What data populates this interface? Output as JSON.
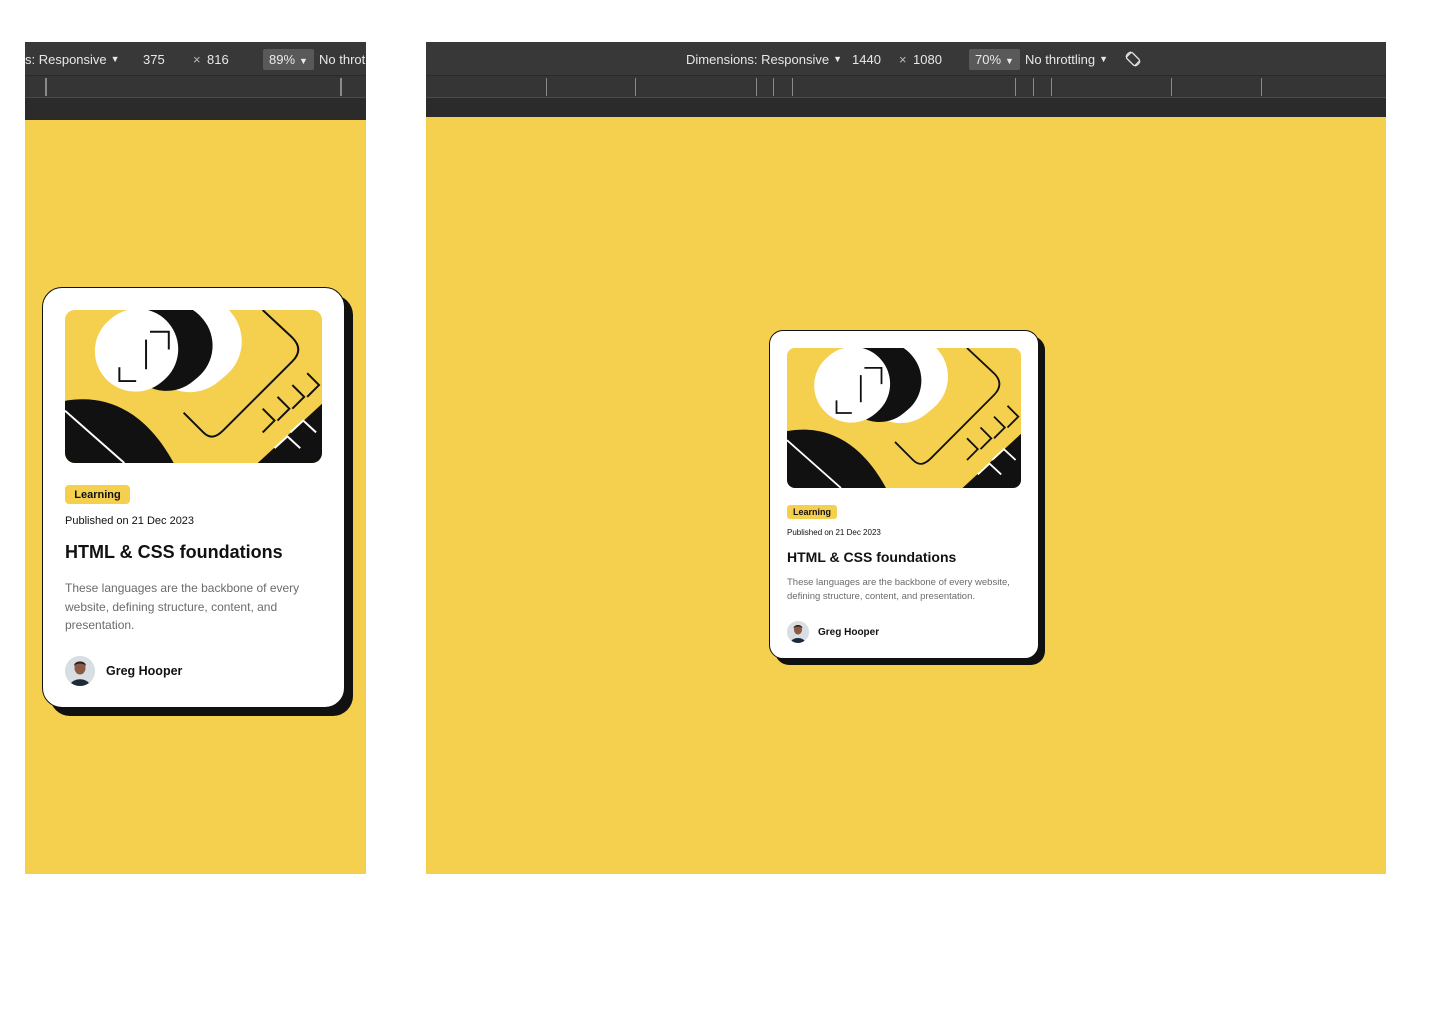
{
  "mobile_toolbar": {
    "dimensions_label": "s: Responsive",
    "width": "375",
    "times": "×",
    "height": "816",
    "zoom": "89%",
    "throttling": "No throt"
  },
  "desktop_toolbar": {
    "dimensions_label": "Dimensions: Responsive",
    "width": "1440",
    "times": "×",
    "height": "1080",
    "zoom": "70%",
    "throttling": "No throttling",
    "rotate_icon": "rotate-icon"
  },
  "card": {
    "tag": "Learning",
    "date": "Published on 21 Dec 2023",
    "title": "HTML & CSS foundations",
    "description": "These languages are the backbone of every website, defining structure, content, and presentation.",
    "author": "Greg Hooper"
  },
  "colors": {
    "background": "#f4d04e",
    "card": "#ffffff",
    "shadow": "#111111",
    "text_muted": "#6b6b6b",
    "devtools_bar": "#383838"
  }
}
